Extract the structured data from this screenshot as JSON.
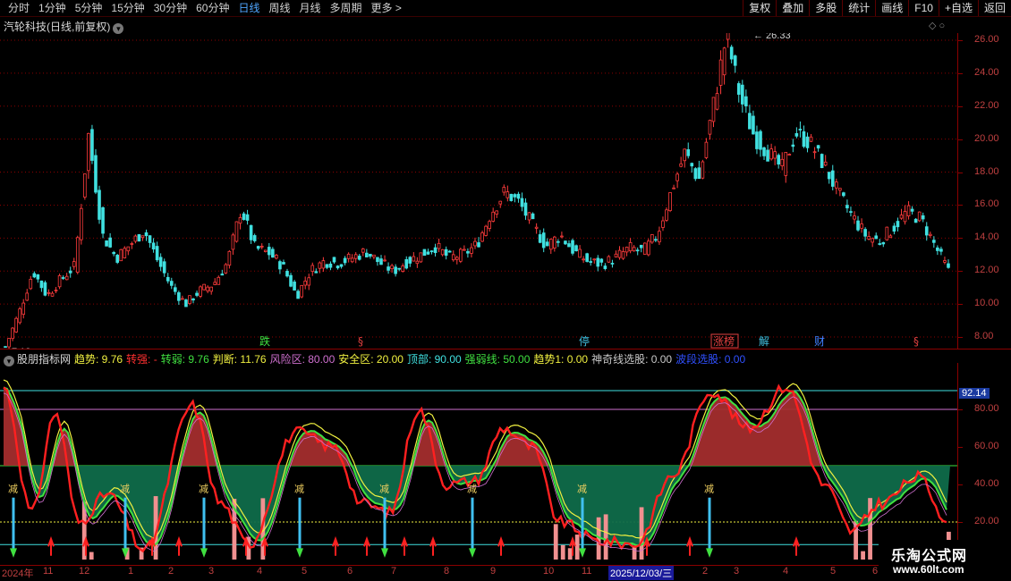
{
  "toolbar": {
    "periods": [
      "分时",
      "1分钟",
      "5分钟",
      "15分钟",
      "30分钟",
      "60分钟",
      "日线",
      "周线",
      "月线",
      "多周期",
      "更多 >"
    ],
    "active_period": "日线",
    "right_tools": [
      "复权",
      "叠加",
      "多股",
      "统计",
      "画线",
      "F10",
      "+自选",
      "返回"
    ]
  },
  "stock": {
    "title": "汽轮科技(日线,前复权)",
    "high_label": "26.33",
    "low_label": "7.13"
  },
  "price_axis": {
    "labels": [
      "26.00",
      "24.00",
      "22.00",
      "20.00",
      "18.00",
      "16.00",
      "14.00",
      "12.00",
      "10.00",
      "8.00"
    ]
  },
  "events": [
    {
      "text": "跌",
      "color": "#40e040"
    },
    {
      "text": "§",
      "color": "#e04040"
    },
    {
      "text": "停",
      "color": "#40c0e0"
    },
    {
      "text": "涨榜",
      "color": "#e04040"
    },
    {
      "text": "解",
      "color": "#40c0e0"
    },
    {
      "text": "财",
      "color": "#4080ff"
    },
    {
      "text": "§",
      "color": "#e04040"
    }
  ],
  "indicator": {
    "name": "股朋指标网",
    "params": [
      {
        "label": "趋势: 9.76",
        "color": "#f0f040"
      },
      {
        "label": "转强: -",
        "color": "#ff3030"
      },
      {
        "label": "转弱: 9.76",
        "color": "#40e040"
      },
      {
        "label": "判断: 11.76",
        "color": "#f0f040"
      },
      {
        "label": "风险区: 80.00",
        "color": "#d070d0"
      },
      {
        "label": "安全区: 20.00",
        "color": "#f0f040"
      },
      {
        "label": "顶部: 90.00",
        "color": "#40e0e0"
      },
      {
        "label": "强弱线: 50.00",
        "color": "#40e040"
      },
      {
        "label": "趋势1: 0.00",
        "color": "#f0f040"
      },
      {
        "label": "神奇线选股: 0.00",
        "color": "#c8c8c8"
      },
      {
        "label": "波段选股: 0.00",
        "color": "#3050ff"
      }
    ],
    "axis_labels": [
      "80.00",
      "60.00",
      "40.00",
      "20.00"
    ],
    "current_value": "92.14",
    "dec_label": "减"
  },
  "date_axis": {
    "labels": [
      "2024年",
      "11",
      "12",
      "1",
      "2",
      "3",
      "4",
      "5",
      "6",
      "7",
      "8",
      "9",
      "10",
      "11",
      "2025/12/03/三",
      "2",
      "3",
      "4",
      "5",
      "6"
    ],
    "highlight": "2025/12/03/三"
  },
  "watermark": {
    "title": "乐淘公式网",
    "url": "www.60lt.com"
  },
  "colors": {
    "up": "#ff3c3c",
    "down": "#40e0e0",
    "grid": "#8b0000",
    "risk": "#a32d2d",
    "safe": "#0f6b4a"
  },
  "chart_data": {
    "type": "line",
    "title": "",
    "ylim": [
      7,
      27
    ],
    "close_path": [
      7.4,
      9.5,
      12.0,
      10.5,
      11.5,
      12.3,
      20.3,
      14.2,
      12.8,
      13.6,
      14.5,
      12.6,
      11.0,
      10.0,
      10.8,
      11.2,
      12.5,
      15.8,
      13.4,
      13.1,
      12.3,
      10.5,
      12.0,
      12.6,
      12.5,
      12.8,
      13.2,
      12.5,
      12.0,
      12.6,
      13.0,
      13.5,
      12.8,
      13.0,
      13.6,
      15.5,
      16.8,
      16.2,
      14.8,
      13.5,
      14.2,
      13.2,
      12.6,
      12.4,
      12.8,
      13.4,
      13.2,
      14.2,
      16.8,
      19.2,
      17.5,
      21.8,
      26.33,
      22.5,
      20.2,
      19.2,
      18.2,
      20.4,
      19.8,
      18.5,
      16.8,
      15.4,
      14.2,
      13.8,
      14.6,
      15.6,
      15.2,
      13.6,
      12.0
    ],
    "indicator_range": [
      0,
      100
    ],
    "risk_line": 80,
    "safe_line": 20,
    "top_line": 90,
    "strength_line": 50
  }
}
